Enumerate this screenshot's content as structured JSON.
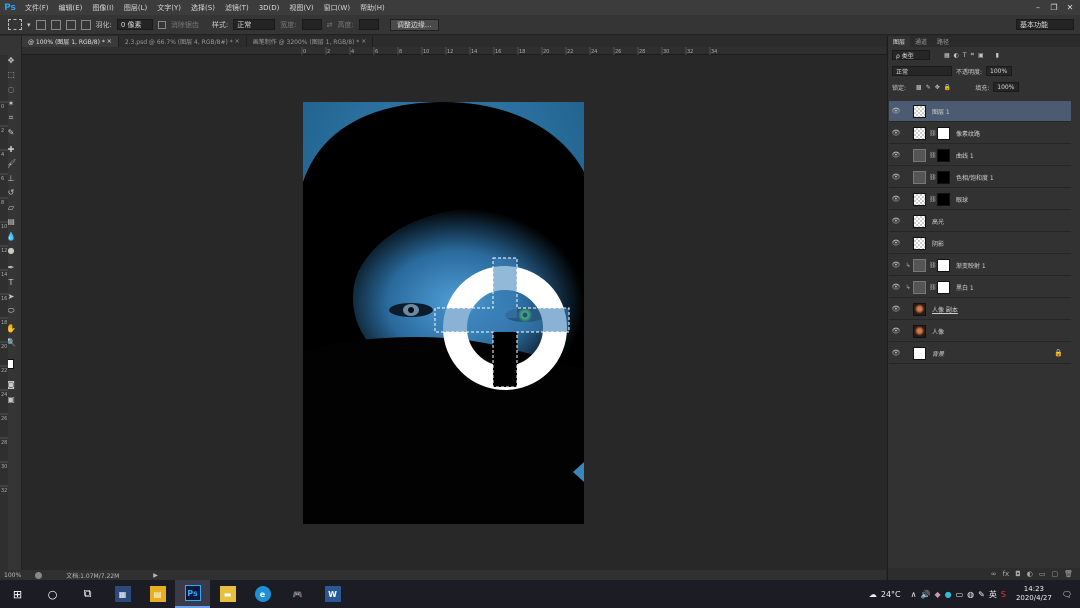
{
  "app": {
    "logo": "Ps",
    "menus": [
      "文件(F)",
      "编辑(E)",
      "图像(I)",
      "图层(L)",
      "文字(Y)",
      "选择(S)",
      "滤镜(T)",
      "3D(D)",
      "视图(V)",
      "窗口(W)",
      "帮助(H)"
    ]
  },
  "options": {
    "feather_label": "羽化:",
    "feather_value": "0 像素",
    "antialias_label": "消除锯齿",
    "style_label": "样式:",
    "style_value": "正常",
    "width_label": "宽度:",
    "height_label": "高度:",
    "refine_edge_button": "调整边缘...",
    "workspace": "基本功能"
  },
  "tabs": [
    {
      "label": "@ 100% (图层 1, RGB/8) *",
      "close": "×"
    },
    {
      "label": "2.3.psd @ 66.7% (图层 4, RGB/8#) *",
      "close": "×"
    },
    {
      "label": "画笔制作 @ 3200% (图层 1, RGB/8) *",
      "close": "×"
    }
  ],
  "ruler_h": [
    "0",
    "2",
    "4",
    "6",
    "8",
    "10",
    "12",
    "14",
    "16",
    "18",
    "20",
    "22",
    "24",
    "26",
    "28",
    "30",
    "32",
    "34"
  ],
  "ruler_v": [
    "0",
    "2",
    "4",
    "6",
    "8",
    "10",
    "12",
    "14",
    "16",
    "18",
    "20",
    "22",
    "24",
    "26",
    "28",
    "30",
    "32"
  ],
  "status": {
    "zoom": "100%",
    "doc_info": "文档:1.07M/7.22M"
  },
  "panel": {
    "tabs": [
      "图层",
      "通道",
      "路径"
    ],
    "filter_kind": "ρ 类型",
    "blend_mode": "正常",
    "opacity_label": "不透明度:",
    "opacity_value": "100%",
    "lock_label": "锁定:",
    "fill_label": "填充:",
    "fill_value": "100%",
    "layers": [
      {
        "name": "图层 1",
        "thumb": "checker"
      },
      {
        "name": "像素纹路",
        "thumb": "checker"
      },
      {
        "name": "曲线 1",
        "thumb": "adj"
      },
      {
        "name": "色相/饱和度 1",
        "thumb": "adj"
      },
      {
        "name": "眼球",
        "thumb": "checker"
      },
      {
        "name": "高光",
        "thumb": "checker"
      },
      {
        "name": "阴影",
        "thumb": "checker"
      },
      {
        "name": "渐变映射 1",
        "thumb": "adj"
      },
      {
        "name": "黑白 1",
        "thumb": "adj"
      },
      {
        "name": "人像 副本",
        "thumb": "face"
      },
      {
        "name": "人像",
        "thumb": "face"
      },
      {
        "name": "背景",
        "thumb": "white"
      }
    ]
  },
  "taskbar": {
    "weather": "24°C",
    "ime": "英",
    "time": "14:23",
    "date": "2020/4/27"
  }
}
